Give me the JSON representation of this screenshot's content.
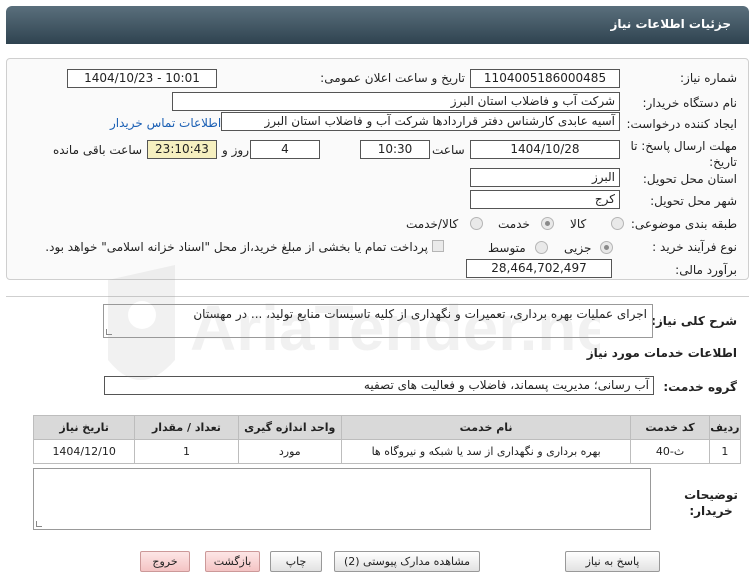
{
  "header": {
    "title": "جزئیات اطلاعات نیاز"
  },
  "form": {
    "need_number_label": "شماره نیاز:",
    "need_number": "1104005186000485",
    "announce_label": "تاریخ و ساعت اعلان عمومی:",
    "announce_value": "1404/10/23 - 10:01",
    "buyer_org_label": "نام دستگاه خریدار:",
    "buyer_org": "شرکت آب و فاضلاب استان البرز",
    "creator_label": "ایجاد کننده درخواست:",
    "creator": "آسیه عابدی کارشناس دفتر قراردادها شرکت آب و فاضلاب استان البرز",
    "contact_link": "اطلاعات تماس خریدار",
    "deadline_label": "مهلت ارسال پاسخ: تا تاریخ:",
    "deadline_date": "1404/10/28",
    "time_label": "ساعت",
    "deadline_time": "10:30",
    "days_value": "4",
    "days_label": "روز و",
    "remaining_time": "23:10:43",
    "remaining_label": "ساعت باقی مانده",
    "province_label": "استان محل تحویل:",
    "province": "البرز",
    "city_label": "شهر محل تحویل:",
    "city": "کرج",
    "category_label": "طبقه بندی موضوعی:",
    "category_options": [
      "کالا",
      "خدمت",
      "کالا/خدمت"
    ],
    "category_selected": "خدمت",
    "process_label": "نوع فرآیند خرید :",
    "process_options": [
      "جزیی",
      "متوسط"
    ],
    "process_selected": "جزیی",
    "treasury_note": "پرداخت تمام یا بخشی از مبلغ خرید،از محل \"اسناد خزانه اسلامی\" خواهد بود.",
    "budget_label": "برآورد مالی:",
    "budget": "28,464,702,497"
  },
  "summary": {
    "label": "شرح کلی نیاز:",
    "text": "اجرای عملیات بهره برداری، تعمیرات و نگهداری از کلیه تاسیسات منابع تولید، ... در مهستان"
  },
  "services": {
    "section_title": "اطلاعات خدمات مورد نیاز",
    "group_label": "گروه خدمت:",
    "group_value": "آب رسانی؛ مدیریت پسماند، فاضلاب و فعالیت های تصفیه",
    "columns": [
      "ردیف",
      "کد خدمت",
      "نام خدمت",
      "واحد اندازه گیری",
      "تعداد / مقدار",
      "تاریخ نیاز"
    ],
    "rows": [
      [
        "1",
        "ث-40",
        "بهره برداری و نگهداری از سد یا شبکه و نیروگاه ها",
        "مورد",
        "1",
        "1404/12/10"
      ]
    ]
  },
  "notes": {
    "label": "توضیحات خریدار:"
  },
  "buttons": {
    "reply": "پاسخ به نیاز",
    "view_docs": "مشاهده مدارک پیوستی (2)",
    "print": "چاپ",
    "back": "بازگشت",
    "exit": "خروج"
  },
  "watermark": {
    "text": "AriaTender.neT"
  },
  "colors": {
    "header_bg": "#3c505d",
    "link": "#1a5fb4",
    "remaining_bg": "#f6f0c0",
    "pink_button": "#f4c4c4"
  }
}
